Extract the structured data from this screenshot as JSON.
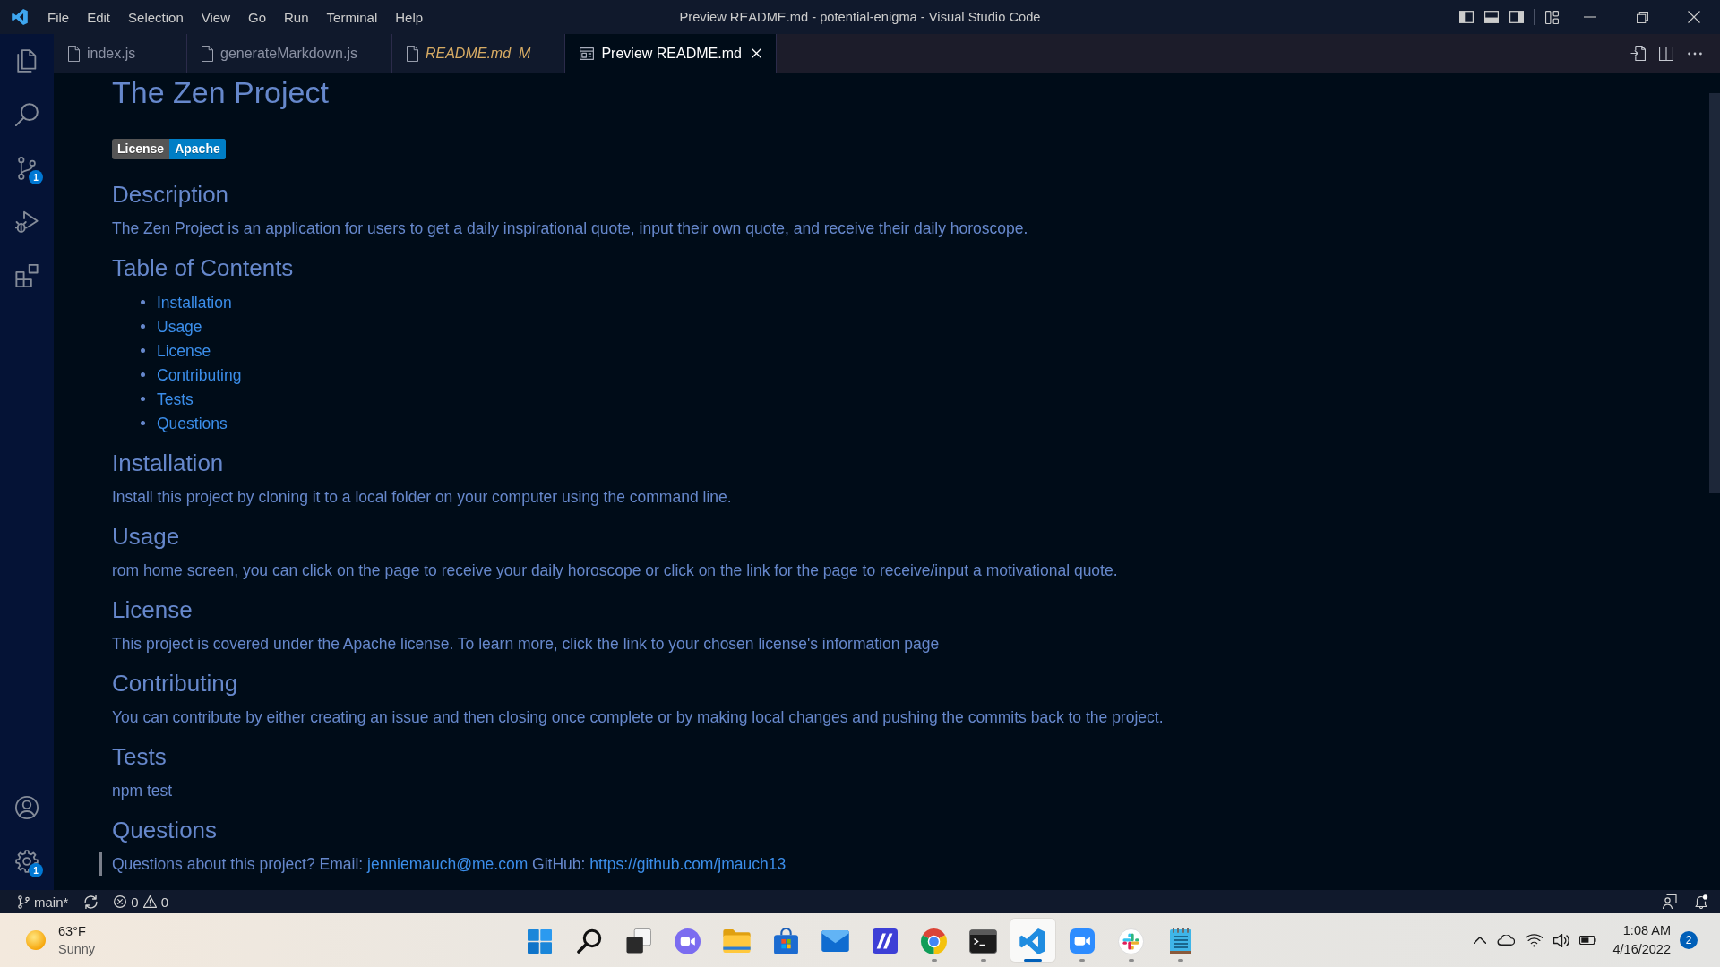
{
  "title_bar": {
    "menu": [
      "File",
      "Edit",
      "Selection",
      "View",
      "Go",
      "Run",
      "Terminal",
      "Help"
    ],
    "title": "Preview README.md - potential-enigma - Visual Studio Code"
  },
  "activity_bar": {
    "source_control_badge": "1",
    "settings_badge": "1"
  },
  "tabs": [
    {
      "label": "index.js",
      "kind": "editor",
      "selected": false,
      "temporary": false
    },
    {
      "label": "generateMarkdown.js",
      "kind": "editor",
      "selected": false,
      "temporary": false
    },
    {
      "label": "README.md",
      "kind": "editor",
      "selected": false,
      "temporary": true,
      "status": "M"
    },
    {
      "label": "Preview README.md",
      "kind": "preview",
      "selected": true,
      "temporary": false
    }
  ],
  "preview": {
    "title": "The Zen Project",
    "badge": {
      "label": "License",
      "value": "Apache"
    },
    "sections": [
      {
        "heading": "Description",
        "kind": "paragraph",
        "text": "The Zen Project is an application for users to get a daily inspirational quote, input their own quote, and receive their daily horoscope."
      },
      {
        "heading": "Table of Contents",
        "kind": "list",
        "items": [
          "Installation",
          "Usage",
          "License",
          "Contributing",
          "Tests",
          "Questions"
        ]
      },
      {
        "heading": "Installation",
        "kind": "paragraph",
        "text": "Install this project by cloning it to a local folder on your computer using the command line."
      },
      {
        "heading": "Usage",
        "kind": "paragraph",
        "text": "rom home screen, you can click on the page to receive your daily horoscope or click on the link for the page to receive/input a motivational quote."
      },
      {
        "heading": "License",
        "kind": "paragraph",
        "text": "This project is covered under the Apache license. To learn more, click the link to your chosen license's information page"
      },
      {
        "heading": "Contributing",
        "kind": "paragraph",
        "text": "You can contribute by either creating an issue and then closing once complete or by making local changes and pushing the commits back to the project."
      },
      {
        "heading": "Tests",
        "kind": "paragraph",
        "text": "npm test"
      },
      {
        "heading": "Questions",
        "kind": "quote",
        "parts": [
          {
            "kind": "text",
            "text": "Questions about this project? Email: "
          },
          {
            "kind": "link",
            "text": "jenniemauch@me.com"
          },
          {
            "kind": "text",
            "text": " GitHub: "
          },
          {
            "kind": "link",
            "text": "https://github.com/jmauch13"
          }
        ]
      }
    ]
  },
  "status_bar": {
    "branch": "main*",
    "errors": "0",
    "warnings": "0"
  },
  "taskbar": {
    "weather": {
      "temperature": "63°F",
      "condition": "Sunny"
    },
    "apps": [
      {
        "running": false,
        "selected": false
      },
      {
        "running": false,
        "selected": false
      },
      {
        "running": false,
        "selected": false
      },
      {
        "running": false,
        "selected": false
      },
      {
        "running": false,
        "selected": false
      },
      {
        "running": false,
        "selected": false
      },
      {
        "running": false,
        "selected": false
      },
      {
        "running": false,
        "selected": false
      },
      {
        "running": true,
        "selected": false
      },
      {
        "running": true,
        "selected": false
      },
      {
        "running": true,
        "selected": true
      },
      {
        "running": true,
        "selected": false
      },
      {
        "running": true,
        "selected": false
      },
      {
        "running": true,
        "selected": false
      }
    ],
    "clock": {
      "time": "1:08 AM",
      "date": "4/16/2022"
    },
    "notifications": "2"
  }
}
